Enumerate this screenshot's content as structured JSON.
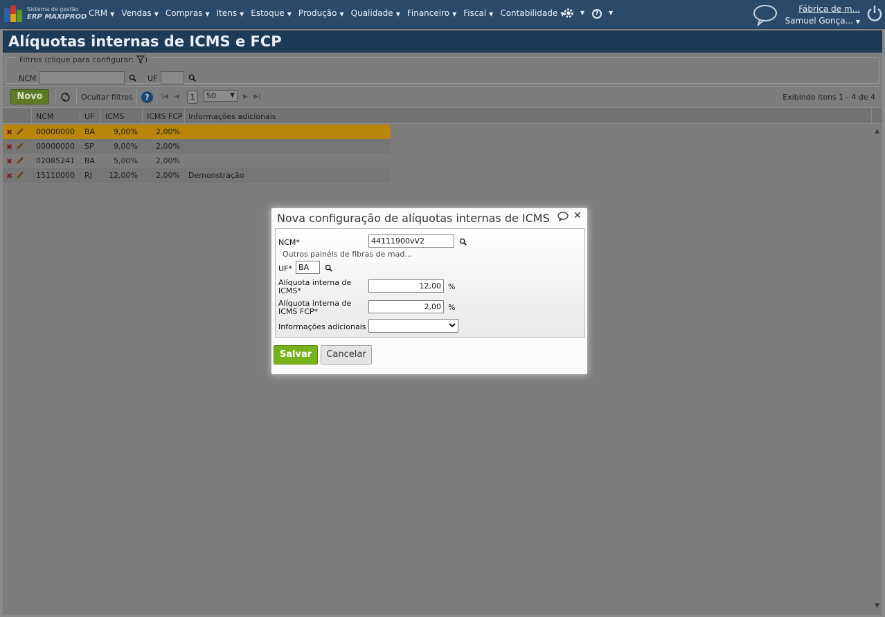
{
  "brand": {
    "line1": "Sistema de gestão",
    "line2": "ERP MAXIPROD"
  },
  "menu": [
    {
      "label": "CRM"
    },
    {
      "label": "Vendas"
    },
    {
      "label": "Compras"
    },
    {
      "label": "Itens"
    },
    {
      "label": "Estoque"
    },
    {
      "label": "Produção"
    },
    {
      "label": "Qualidade"
    },
    {
      "label": "Financeiro"
    },
    {
      "label": "Fiscal"
    },
    {
      "label": "Contabilidade"
    }
  ],
  "header": {
    "company": "Fábrica de m...",
    "user": "Samuel Gonça..."
  },
  "page_title": "Alíquotas internas de ICMS e FCP",
  "filters": {
    "legend": "Filtros (clique para configurar:",
    "legend_close": ")",
    "ncm_label": "NCM",
    "ncm_value": "",
    "uf_label": "UF",
    "uf_value": ""
  },
  "toolbar": {
    "novo": "Novo",
    "hide_filters": "Ocultar filtros",
    "help": "?",
    "page": "1",
    "page_size": "50",
    "showing": "Exibindo itens 1 - 4 de 4"
  },
  "grid": {
    "columns": [
      "NCM",
      "UF",
      "ICMS",
      "ICMS FCP",
      "Informações adicionais"
    ],
    "rows": [
      {
        "ncm": "00000000",
        "uf": "BA",
        "icms": "9,00%",
        "fcp": "2,00%",
        "info": ""
      },
      {
        "ncm": "00000000",
        "uf": "SP",
        "icms": "9,00%",
        "fcp": "2,00%",
        "info": ""
      },
      {
        "ncm": "02085241",
        "uf": "BA",
        "icms": "5,00%",
        "fcp": "2,00%",
        "info": ""
      },
      {
        "ncm": "15110000",
        "uf": "RJ",
        "icms": "12,00%",
        "fcp": "2,00%",
        "info": "Demonstração"
      }
    ],
    "selected_row_color": "#b8860b"
  },
  "modal": {
    "title": "Nova configuração de alíquotas internas de ICMS",
    "ncm_label": "NCM*",
    "ncm_value": "44111900vV2",
    "ncm_description": "Outros painéis de fibras de mad...",
    "uf_label": "UF*",
    "uf_value": "BA",
    "icms_label_1": "Alíquota interna de",
    "icms_label_2": "ICMS*",
    "icms_value": "12,00",
    "fcp_label_1": "Alíquota interna de",
    "fcp_label_2": "ICMS FCP*",
    "fcp_value": "2,00",
    "percent": "%",
    "info_label": "Informações adicionais",
    "info_value": "",
    "save": "Salvar",
    "cancel": "Cancelar"
  },
  "colors": {
    "nav": "#2b4a6a",
    "title_bar": "#1d3a56",
    "save_green": "#78b21a",
    "novo_green": "#5c7a28"
  }
}
